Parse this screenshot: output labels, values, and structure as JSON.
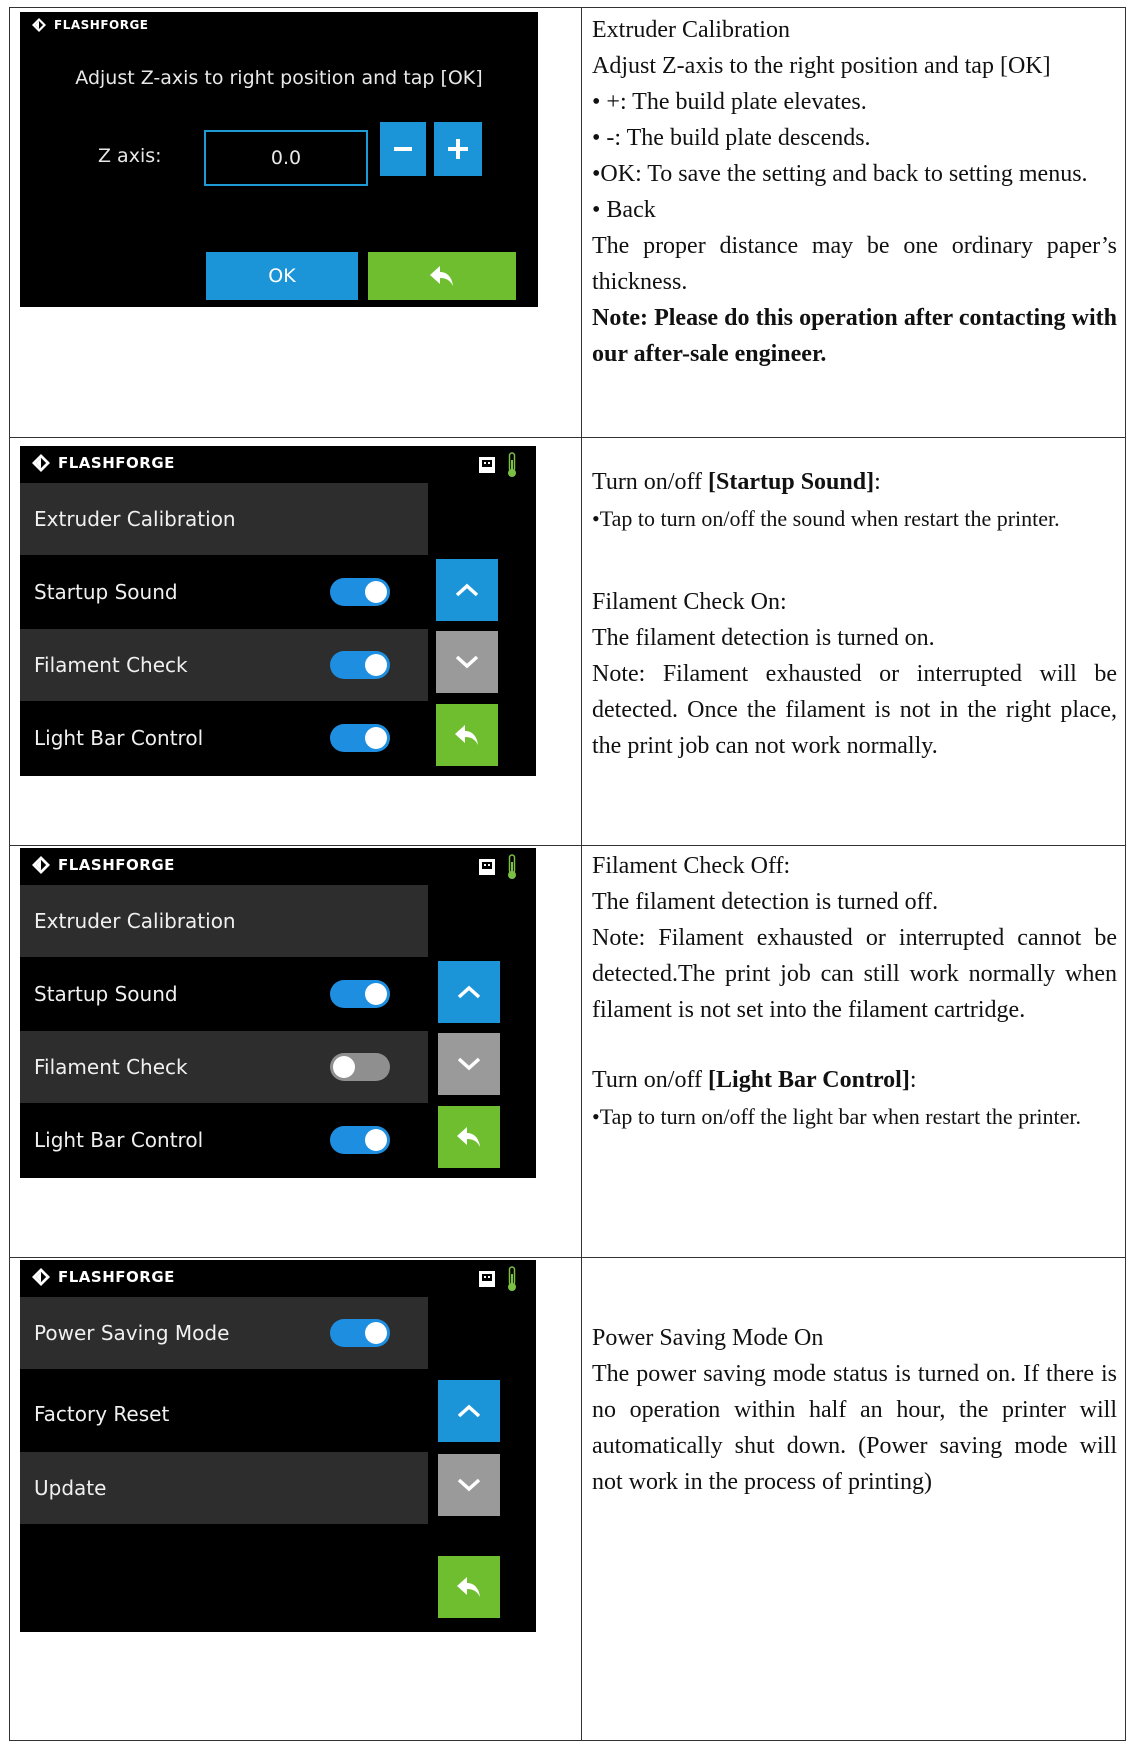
{
  "brand": {
    "name": "FLASHFORGE"
  },
  "colors": {
    "accent_blue": "#1b95d8",
    "back_green": "#6fbe2f",
    "disabled_gray": "#9a9a9a",
    "toggle_on": "#1e8fe0",
    "toggle_off": "#8f8f8f"
  },
  "icons": [
    "flashforge-logo-icon",
    "usb-icon",
    "thermometer-icon",
    "chevron-up-icon",
    "chevron-down-icon",
    "back-arrow-icon",
    "minus-icon",
    "plus-icon"
  ],
  "calibration_screen": {
    "instruction": "Adjust Z-axis to right position and tap [OK]",
    "z_label": "Z axis:",
    "z_value": "0.0",
    "ok_label": "OK"
  },
  "screen2": {
    "rows": [
      {
        "label": "Extruder Calibration",
        "toggle": null
      },
      {
        "label": "Startup Sound",
        "toggle": "on"
      },
      {
        "label": "Filament Check",
        "toggle": "on"
      },
      {
        "label": "Light Bar Control",
        "toggle": "on"
      }
    ]
  },
  "screen3": {
    "rows": [
      {
        "label": "Extruder Calibration",
        "toggle": null
      },
      {
        "label": "Startup Sound",
        "toggle": "on"
      },
      {
        "label": "Filament Check",
        "toggle": "off"
      },
      {
        "label": "Light Bar Control",
        "toggle": "on"
      }
    ]
  },
  "screen4": {
    "rows": [
      {
        "label": "Power Saving Mode",
        "toggle": "on"
      },
      {
        "label": "Factory Reset",
        "toggle": null
      },
      {
        "label": "Update",
        "toggle": null
      }
    ]
  },
  "text1": {
    "title": "Extruder Calibration",
    "instruction": "Adjust Z-axis to the right position and tap [OK]",
    "b1": "• +: The build plate elevates.",
    "b2": "• -: The build plate descends.",
    "b3": "•OK: To save the setting and back to setting menus.",
    "b4": "• Back",
    "distance": "The proper distance may be one ordinary paper’s thickness.",
    "note": "Note: Please do this operation after contacting with our after-sale engineer."
  },
  "text2": {
    "turn_prefix": "Turn on/off ",
    "turn_bold": "[Startup Sound]",
    "turn_suffix": ":",
    "tap": "•Tap to turn on/off the sound when restart the printer.",
    "fc_on_title": "Filament Check On:",
    "fc_on_desc": "The filament detection is turned on.",
    "fc_on_note": "Note: Filament exhausted or interrupted will be detected. Once the filament is not in the right place, the print job can not work normally."
  },
  "text3": {
    "fc_off_title": "Filament Check Off:",
    "fc_off_desc": "The filament detection is turned off.",
    "fc_off_note": "Note: Filament exhausted or interrupted cannot be detected.The print job can still work normally when filament is not set into the filament cartridge.",
    "turn_prefix": "Turn on/off ",
    "turn_bold": "[Light Bar Control]",
    "turn_suffix": ":",
    "tap": "•Tap to turn on/off the light bar when restart the printer."
  },
  "text4": {
    "title": "Power Saving Mode On",
    "desc": "The power saving mode status is turned on. If there is no operation within half an hour, the printer will automatically shut down. (Power saving mode will not work in the process of printing)"
  }
}
